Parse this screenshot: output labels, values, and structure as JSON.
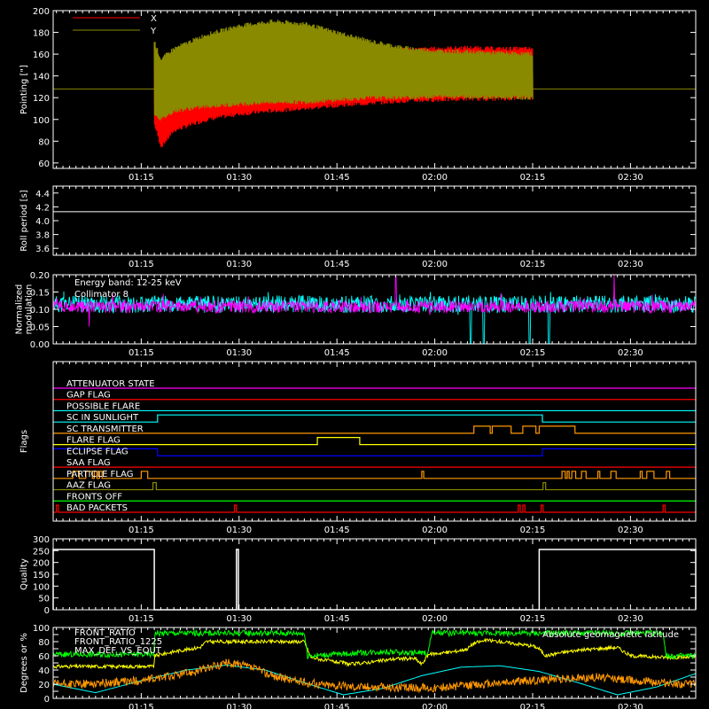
{
  "time_axis": {
    "ticks": [
      "01:15",
      "01:30",
      "01:45",
      "02:00",
      "02:15",
      "02:30"
    ],
    "tick_minutes": [
      75,
      90,
      105,
      120,
      135,
      150
    ],
    "range_minutes": [
      61.5,
      160
    ]
  },
  "colors": {
    "background": "#000000",
    "axes": "#ffffff",
    "x_series": "#ff0000",
    "y_series": "#8a8a00",
    "cyan": "#00ffff",
    "magenta": "#ff00ff",
    "green": "#00ff00",
    "yellow": "#ffff00",
    "orange": "#ff9900",
    "blue": "#0000ff"
  },
  "chart_data": [
    {
      "id": "pointing",
      "type": "line",
      "ylabel": "Pointing [\"]",
      "ylim": [
        55,
        200
      ],
      "yticks": [
        60,
        80,
        100,
        120,
        140,
        160,
        180,
        200
      ],
      "baseline": 128,
      "data_start_minutes": 77,
      "data_end_minutes": 135,
      "series": [
        {
          "name": "X",
          "color": "#ff0000",
          "x": [
            77,
            78,
            80,
            85,
            90,
            95,
            100,
            105,
            110,
            115,
            120,
            125,
            130,
            135
          ],
          "upper": [
            170,
            150,
            152,
            155,
            158,
            160,
            162,
            163,
            163,
            164,
            165,
            166,
            165,
            165
          ],
          "lower": [
            95,
            75,
            90,
            100,
            105,
            108,
            110,
            113,
            115,
            117,
            118,
            119,
            119,
            120
          ]
        },
        {
          "name": "Y",
          "color": "#8a8a00",
          "x": [
            77,
            78,
            80,
            85,
            90,
            95,
            100,
            105,
            110,
            115,
            120,
            125,
            130,
            135
          ],
          "upper": [
            172,
            155,
            165,
            178,
            186,
            190,
            188,
            180,
            172,
            166,
            163,
            162,
            161,
            160
          ],
          "lower": [
            105,
            100,
            108,
            112,
            114,
            116,
            116,
            118,
            120,
            120,
            121,
            121,
            120,
            120
          ]
        }
      ]
    },
    {
      "id": "roll_period",
      "type": "line",
      "ylabel": "Roll period [s]",
      "ylim": [
        3.5,
        4.5
      ],
      "yticks": [
        3.6,
        3.8,
        4.0,
        4.2,
        4.4
      ],
      "yticklabels": [
        "3.6",
        "3.8",
        "4.0",
        "4.2",
        "4.4"
      ],
      "series": [
        {
          "x": [
            61.5,
            160
          ],
          "y": [
            4.13,
            4.13
          ],
          "color": "#ffffff"
        }
      ]
    },
    {
      "id": "modulation",
      "type": "line",
      "ylabel": "Normalized modulation",
      "ylabel_lines": [
        "Normalized",
        "modulation"
      ],
      "ylim": [
        0,
        0.2
      ],
      "yticks": [
        0,
        0.05,
        0.1,
        0.15,
        0.2
      ],
      "yticklabels": [
        "0.00",
        "0.05",
        "0.10",
        "0.15",
        "0.20"
      ],
      "annotations": [
        "Energy band: 12-25 keV"
      ],
      "series": [
        {
          "name": "Collimator 8",
          "color": "#00ffff",
          "mean": 0.115,
          "noise": 0.025,
          "dropouts": [
            125.5,
            127.5,
            134.5,
            137.5
          ]
        },
        {
          "name": "",
          "color": "#ff00ff",
          "mean": 0.108,
          "noise": 0.018,
          "spikes": [
            [
              67,
              0.05
            ],
            [
              114,
              0.195
            ],
            [
              147.5,
              0.205
            ]
          ]
        }
      ]
    },
    {
      "id": "flags",
      "type": "step",
      "ylabel": "Flags",
      "series": [
        {
          "name": "ATTENUATOR STATE",
          "color": "#ff00ff",
          "steps": []
        },
        {
          "name": "GAP FLAG",
          "color": "#ff0000",
          "steps": []
        },
        {
          "name": "POSSIBLE FLARE",
          "color": "#00ffff",
          "steps": []
        },
        {
          "name": "SC IN SUNLIGHT",
          "color": "#00ffff",
          "steps": [
            [
              77.5,
              136.5
            ]
          ]
        },
        {
          "name": "SC TRANSMITTER",
          "color": "#ff9900",
          "steps": [
            [
              126,
              128.5
            ],
            [
              128.8,
              131.7
            ],
            [
              133.5,
              135.5
            ],
            [
              136,
              141.5
            ]
          ]
        },
        {
          "name": "FLARE FLAG",
          "color": "#ffff00",
          "steps": [
            [
              102,
              108.5
            ]
          ]
        },
        {
          "name": "ECLIPSE FLAG",
          "color": "#0000ff",
          "steps": [
            [
              61.5,
              77.5
            ],
            [
              136.5,
              160
            ]
          ],
          "inverted": true
        },
        {
          "name": "SAA FLAG",
          "color": "#ff0000",
          "steps": []
        },
        {
          "name": "PARTICLE FLAG",
          "color": "#ff9900",
          "steps": [
            [
              64.5,
              65.5
            ],
            [
              66.5,
              67.5
            ],
            [
              67.8,
              68.2
            ],
            [
              68.6,
              69
            ],
            [
              75,
              76
            ],
            [
              118,
              118.3
            ],
            [
              139.5,
              140
            ],
            [
              140.3,
              140.6
            ],
            [
              141,
              141.6
            ],
            [
              142.5,
              143.2
            ],
            [
              145,
              145.3
            ],
            [
              147,
              147.8
            ],
            [
              151.5,
              151.8
            ],
            [
              152.5,
              153.6
            ],
            [
              155.5,
              156
            ]
          ]
        },
        {
          "name": "AAZ FLAG",
          "color": "#8a8a00",
          "steps": [
            [
              76.8,
              77.3
            ],
            [
              136.6,
              137
            ]
          ]
        },
        {
          "name": "FRONTS OFF",
          "color": "#00ff00",
          "steps": []
        },
        {
          "name": "BAD PACKETS",
          "color": "#ff0000",
          "steps": [
            [
              62,
              62.3
            ],
            [
              89.3,
              89.6
            ],
            [
              132.8,
              133.1
            ],
            [
              133.5,
              133.8
            ],
            [
              136.3,
              136.6
            ],
            [
              155,
              155.3
            ]
          ]
        }
      ]
    },
    {
      "id": "quality",
      "type": "step",
      "ylabel": "Quality",
      "ylim": [
        0,
        300
      ],
      "yticks": [
        0,
        50,
        100,
        150,
        200,
        250,
        300
      ],
      "series": [
        {
          "color": "#ffffff",
          "segments": [
            [
              61.5,
              77,
              255
            ],
            [
              89.6,
              89.9,
              255
            ],
            [
              136,
              160,
              255
            ]
          ]
        }
      ]
    },
    {
      "id": "front_ratio",
      "type": "line",
      "ylabel": "Degrees or %",
      "ylim": [
        0,
        100
      ],
      "yticks": [
        0,
        10,
        20,
        30,
        40,
        50,
        60,
        70,
        80,
        90,
        100
      ],
      "yticklabels": [
        "0",
        "",
        "20",
        "",
        "40",
        "",
        "60",
        "",
        "80",
        "",
        "100"
      ],
      "series": [
        {
          "name": "FRONT_RATIO",
          "color": "#ffff00",
          "x": [
            61.5,
            76.9,
            77.1,
            80,
            84,
            85,
            100,
            101,
            103,
            106,
            107,
            111,
            114,
            117,
            118,
            119,
            123,
            124,
            125,
            126,
            128,
            130,
            135,
            136,
            137,
            139,
            142,
            145,
            148,
            150,
            155,
            160
          ],
          "y": [
            45,
            45,
            60,
            66,
            72,
            80,
            80,
            58,
            54,
            50,
            48,
            52,
            56,
            56,
            48,
            62,
            66,
            68,
            70,
            78,
            82,
            80,
            74,
            70,
            60,
            64,
            68,
            70,
            72,
            60,
            58,
            58
          ]
        },
        {
          "name": "FRONT_RATIO_1225",
          "color": "#00ff00",
          "x": [
            61.5,
            76.9,
            77.1,
            100,
            100.5,
            104,
            108,
            112,
            116,
            119,
            119.5,
            140,
            150,
            155,
            155.5,
            160
          ],
          "y": [
            62,
            62,
            92,
            92,
            60,
            62,
            64,
            66,
            64,
            64,
            92,
            92,
            92,
            92,
            60,
            60
          ]
        },
        {
          "name": "MAX_DEF_VS_EQUT",
          "color": "#ff9900",
          "x": [
            61.5,
            65,
            70,
            75,
            80,
            85,
            88,
            90,
            93,
            95,
            100,
            105,
            110,
            115,
            120,
            125,
            130,
            135,
            140,
            145,
            150,
            155,
            160
          ],
          "y": [
            20,
            20,
            22,
            25,
            32,
            42,
            50,
            48,
            40,
            32,
            22,
            18,
            16,
            15,
            15,
            18,
            22,
            25,
            28,
            30,
            26,
            22,
            20
          ]
        },
        {
          "name": "Absolute geomagnetic latitude",
          "color": "#00ffff",
          "x": [
            61.5,
            68,
            75,
            82,
            88,
            94,
            100,
            106,
            112,
            118,
            124,
            130,
            136,
            142,
            148,
            154,
            160
          ],
          "y": [
            20,
            8,
            25,
            40,
            47,
            40,
            22,
            5,
            14,
            32,
            44,
            46,
            38,
            22,
            5,
            16,
            35
          ]
        }
      ]
    }
  ]
}
